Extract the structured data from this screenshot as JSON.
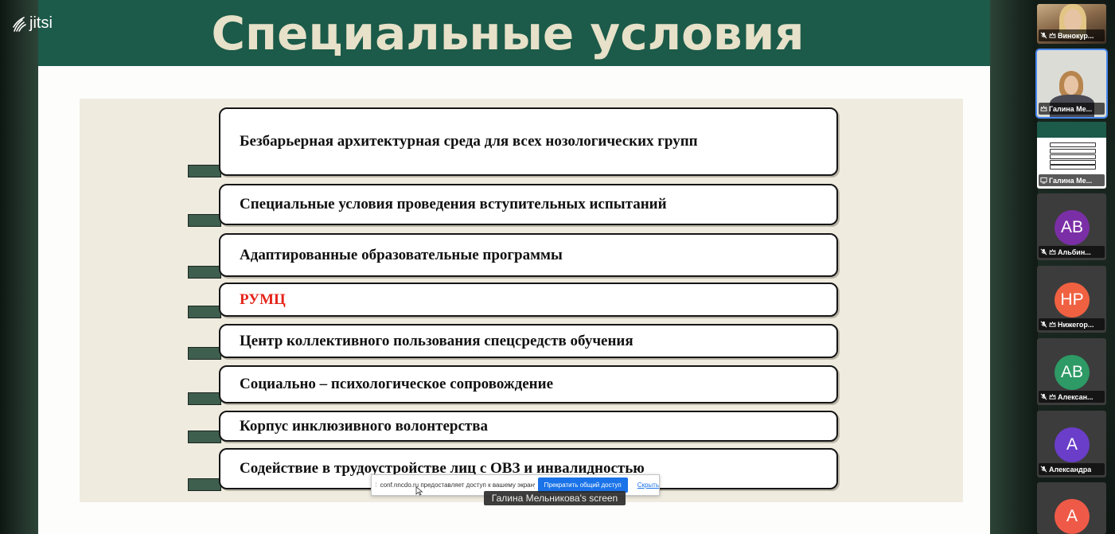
{
  "app": {
    "logo_text": "jitsi"
  },
  "slide": {
    "title": "Специальные условия",
    "items": [
      {
        "text": "Безбарьерная архитектурная среда для всех нозологических групп",
        "color": "#111111"
      },
      {
        "text": "Специальные условия проведения вступительных испытаний",
        "color": "#111111"
      },
      {
        "text": "Адаптированные образовательные программы",
        "color": "#111111"
      },
      {
        "text": "РУМЦ",
        "color": "#e5241a"
      },
      {
        "text": "Центр коллективного пользования спецсредств обучения",
        "color": "#111111"
      },
      {
        "text": "Социально – психологическое сопровождение",
        "color": "#111111"
      },
      {
        "text": "Корпус инклюзивного волонтерства",
        "color": "#111111"
      },
      {
        "text": "Содействие в трудоустройстве лиц с ОВЗ и инвалидностью",
        "color": "#111111"
      }
    ]
  },
  "share_bar": {
    "message": "conf.nncdo.ru предоставляет доступ к вашему экрану.",
    "stop_label": "Прекратить общий доступ",
    "hide_label": "Скрыть"
  },
  "screen_label": "Галина Мельникова's screen",
  "participants": [
    {
      "name": "Винокур...",
      "type": "video",
      "muted": true,
      "moderator": true
    },
    {
      "name": "Галина Ме...",
      "type": "video",
      "muted": false,
      "moderator": true,
      "selected": true
    },
    {
      "name": "Галина Ме...",
      "type": "screen",
      "muted": false,
      "moderator": false
    },
    {
      "name": "Альбин...",
      "type": "avatar",
      "initials": "AB",
      "color": "#7b2fa6",
      "muted": true,
      "moderator": true
    },
    {
      "name": "Нижегор...",
      "type": "avatar",
      "initials": "HP",
      "color": "#f06141",
      "muted": true,
      "moderator": true
    },
    {
      "name": "Алексан...",
      "type": "avatar",
      "initials": "AB",
      "color": "#2e9a66",
      "muted": true,
      "moderator": true
    },
    {
      "name": "Александра",
      "type": "avatar",
      "initials": "A",
      "color": "#6a3ec9",
      "muted": true,
      "moderator": false
    },
    {
      "name": "",
      "type": "avatar",
      "initials": "A",
      "color": "#ef5a48",
      "muted": false,
      "moderator": false
    }
  ],
  "colors": {
    "header_green": "#1c5a49",
    "title_text": "#e6e1c8",
    "selected_outline": "#4687ed"
  }
}
